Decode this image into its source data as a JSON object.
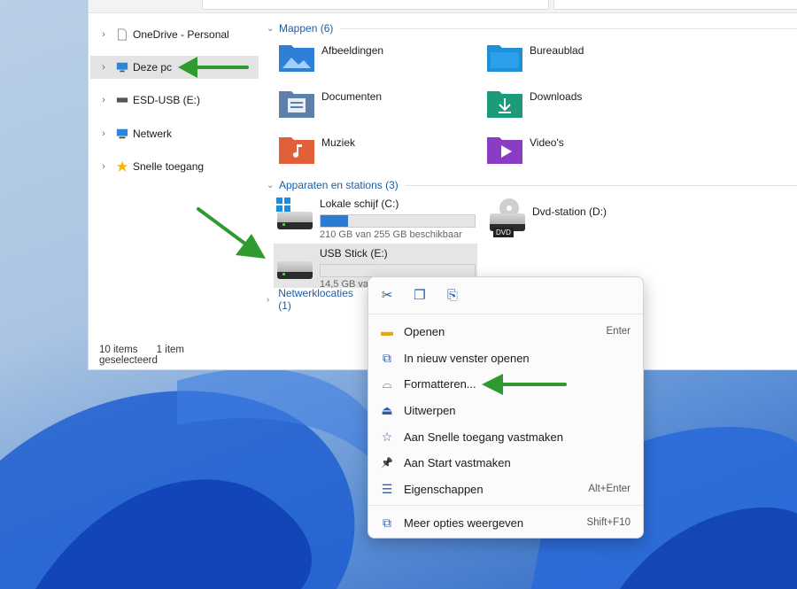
{
  "nav": {
    "items": [
      {
        "label": "OneDrive - Personal",
        "icon": "document-icon"
      },
      {
        "label": "Deze pc",
        "icon": "computer-icon"
      },
      {
        "label": "ESD-USB (E:)",
        "icon": "usb-drive-icon"
      },
      {
        "label": "Netwerk",
        "icon": "network-icon"
      },
      {
        "label": "Snelle toegang",
        "icon": "star-icon"
      }
    ]
  },
  "status": {
    "count": "10 items",
    "selected": "1 item geselecteerd"
  },
  "groups": {
    "folders": "Mappen (6)",
    "devices": "Apparaten en stations (3)",
    "network": "Netwerklocaties (1)"
  },
  "folders": [
    {
      "label": "Afbeeldingen",
      "icon": "pictures-folder-icon",
      "color": "#2f7ed8"
    },
    {
      "label": "Bureaublad",
      "icon": "desktop-folder-icon",
      "color": "#1f8fd8"
    },
    {
      "label": "Documenten",
      "icon": "documents-folder-icon",
      "color": "#5e7fa8"
    },
    {
      "label": "Downloads",
      "icon": "downloads-folder-icon",
      "color": "#1c9b7b"
    },
    {
      "label": "Muziek",
      "icon": "music-folder-icon",
      "color": "#e0603a"
    },
    {
      "label": "Video's",
      "icon": "videos-folder-icon",
      "color": "#8a3cc4"
    }
  ],
  "drives": [
    {
      "name": "Lokale schijf (C:)",
      "free": "210 GB van 255 GB beschikbaar",
      "used_fraction": 0.18
    },
    {
      "name": "Dvd-station (D:)",
      "badge": "DVD"
    },
    {
      "name": "USB Stick (E:)",
      "free": "14,5 GB va",
      "used_fraction": 0.0
    }
  ],
  "context_menu": {
    "quick_actions": [
      {
        "icon": "cut-icon",
        "glyph": "✂"
      },
      {
        "icon": "copy-icon",
        "glyph": "❐"
      },
      {
        "icon": "rename-icon",
        "glyph": "⎘"
      }
    ],
    "items": [
      {
        "label": "Openen",
        "shortcut": "Enter",
        "icon": "folder-open-icon",
        "glyph": "▬"
      },
      {
        "label": "In nieuw venster openen",
        "shortcut": "",
        "icon": "open-new-window-icon",
        "glyph": "⧉"
      },
      {
        "label": "Formatteren...",
        "shortcut": "",
        "icon": "format-icon",
        "glyph": "⌓"
      },
      {
        "label": "Uitwerpen",
        "shortcut": "",
        "icon": "eject-icon",
        "glyph": "⏏"
      },
      {
        "label": "Aan Snelle toegang vastmaken",
        "shortcut": "",
        "icon": "star-outline-icon",
        "glyph": "☆"
      },
      {
        "label": "Aan Start vastmaken",
        "shortcut": "",
        "icon": "pin-icon",
        "glyph": "📌"
      },
      {
        "label": "Eigenschappen",
        "shortcut": "Alt+Enter",
        "icon": "properties-icon",
        "glyph": "☰"
      },
      {
        "label": "Meer opties weergeven",
        "shortcut": "Shift+F10",
        "icon": "more-options-icon",
        "glyph": "⧉"
      }
    ]
  },
  "colors": {
    "accent": "#2b7bd3",
    "arrow": "#2f9a2f",
    "group_header": "#1a5da8"
  }
}
